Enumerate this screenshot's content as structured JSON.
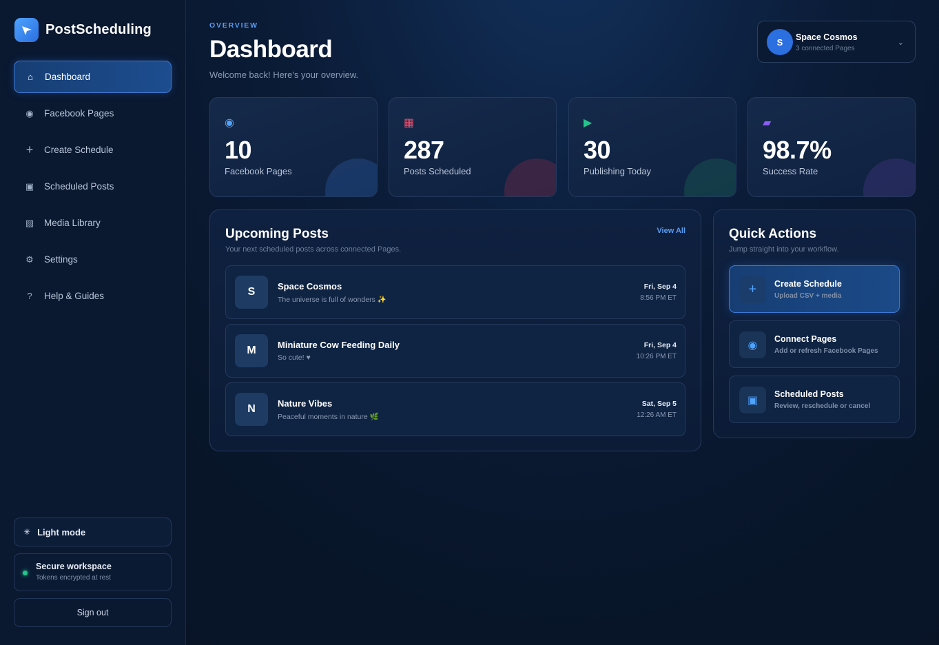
{
  "brand": {
    "name": "PostScheduling"
  },
  "nav": [
    {
      "label": "Dashboard",
      "icon": "home-icon",
      "glyph": "⌂",
      "active": true
    },
    {
      "label": "Facebook Pages",
      "icon": "target-icon",
      "glyph": "◉"
    },
    {
      "label": "Create Schedule",
      "icon": "plus-icon",
      "glyph": "+"
    },
    {
      "label": "Scheduled Posts",
      "icon": "square-icon",
      "glyph": "▣"
    },
    {
      "label": "Media Library",
      "icon": "image-icon",
      "glyph": "▧"
    },
    {
      "label": "Settings",
      "icon": "gear-icon",
      "glyph": "⚙"
    },
    {
      "label": "Help & Guides",
      "icon": "question-icon",
      "glyph": "?"
    }
  ],
  "sidebar_footer": {
    "light_mode": "Light mode",
    "light_mode_glyph": "✳",
    "secure_title": "Secure workspace",
    "secure_sub": "Tokens encrypted at rest",
    "sign_out": "Sign out"
  },
  "header": {
    "overline": "OVERVIEW",
    "title": "Dashboard",
    "subtitle": "Welcome back! Here's your overview."
  },
  "account": {
    "initial": "S",
    "name": "Space Cosmos",
    "sub": "3 connected Pages",
    "chevron": "⌄"
  },
  "stats": [
    {
      "value": "10",
      "label": "Facebook Pages",
      "glyph": "◉",
      "color": "#4ea3ff",
      "deco": "#2b5ea8"
    },
    {
      "value": "287",
      "label": "Posts Scheduled",
      "glyph": "▦",
      "color": "#f0506e",
      "deco": "#8a2a4a"
    },
    {
      "value": "30",
      "label": "Publishing Today",
      "glyph": "▶",
      "color": "#22c58b",
      "deco": "#1a6b55"
    },
    {
      "value": "98.7%",
      "label": "Success Rate",
      "glyph": "▰",
      "color": "#8b5cf6",
      "deco": "#4a3a8a"
    }
  ],
  "upcoming": {
    "title": "Upcoming Posts",
    "subtitle": "Your next scheduled posts across connected Pages.",
    "view_all": "View All",
    "posts": [
      {
        "initial": "S",
        "name": "Space Cosmos",
        "text": "The universe is full of wonders ✨",
        "date": "Fri, Sep 4",
        "time": "8:56 PM ET"
      },
      {
        "initial": "M",
        "name": "Miniature Cow Feeding Daily",
        "text": "So cute! ♥",
        "date": "Fri, Sep 4",
        "time": "10:26 PM ET"
      },
      {
        "initial": "N",
        "name": "Nature Vibes",
        "text": "Peaceful moments in nature 🌿",
        "date": "Sat, Sep 5",
        "time": "12:26 AM ET"
      }
    ]
  },
  "quick_actions": {
    "title": "Quick Actions",
    "subtitle": "Jump straight into your workflow.",
    "items": [
      {
        "title": "Create Schedule",
        "sub": "Upload CSV + media",
        "glyph": "+",
        "icon": "plus-icon"
      },
      {
        "title": "Connect Pages",
        "sub": "Add or refresh Facebook Pages",
        "glyph": "◉",
        "icon": "target-icon"
      },
      {
        "title": "Scheduled Posts",
        "sub": "Review, reschedule or cancel",
        "glyph": "▣",
        "icon": "square-icon"
      }
    ]
  }
}
